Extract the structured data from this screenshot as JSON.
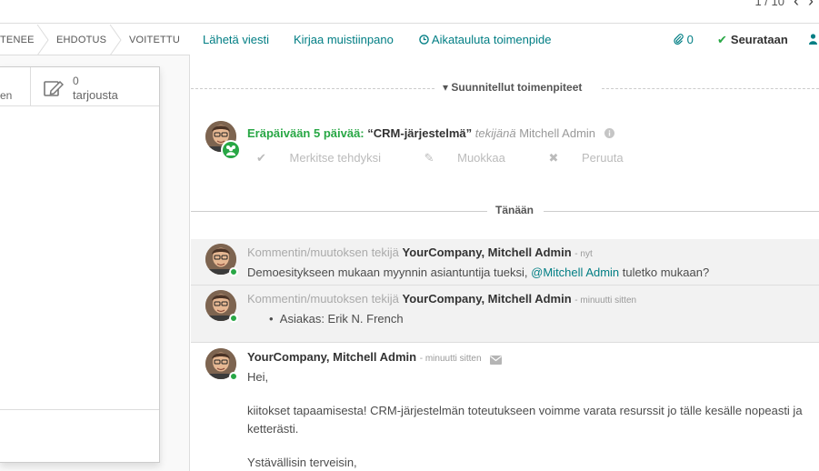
{
  "pager": {
    "text": "1 / 10",
    "prev_icon": "chevron-left-icon",
    "next_icon": "chevron-right-icon"
  },
  "statusbar": {
    "stages": [
      "TENEE",
      "EHDOTUS",
      "VOITETTU"
    ]
  },
  "stat_buttons": {
    "left_partial_label": "en",
    "quotations_count": "0",
    "quotations_label": "tarjousta",
    "icon": "pencil-square-icon"
  },
  "chatter": {
    "send_message": "Lähetä viesti",
    "log_note": "Kirjaa muistiinpano",
    "schedule_activity": "Aikatauluta toimenpide",
    "attachments_count": "0",
    "following_label": "Seurataan",
    "follow_check_icon": "check-icon",
    "person_icon": "user-icon"
  },
  "planned": {
    "separator": "Suunnitellut toimenpiteet",
    "activity": {
      "due": "Eräpäivään 5 päivää:",
      "title": "“CRM-järjestelmä”",
      "for_label": "tekijänä",
      "user": "Mitchell Admin",
      "mark_done": "Merkitse tehdyksi",
      "edit": "Muokkaa",
      "cancel": "Peruuta",
      "badge_icon": "meeting-group-icon"
    }
  },
  "today_separator": "Tänään",
  "messages": [
    {
      "type": "note",
      "prefix": "Kommentin/muutoksen tekijä",
      "author": "YourCompany, Mitchell Admin",
      "when": "- nyt",
      "body_before": "Demoesitykseen mukaan myynnin asiantuntija tueksi, ",
      "mention": "@Mitchell Admin",
      "body_after": " tuletko mukaan?"
    },
    {
      "type": "note",
      "prefix": "Kommentin/muutoksen tekijä",
      "author": "YourCompany, Mitchell Admin",
      "when": "- minuutti sitten",
      "bullet": "Asiakas: Erik N. French"
    },
    {
      "type": "email",
      "author": "YourCompany, Mitchell Admin",
      "when": "- minuutti sitten",
      "line1": "Hei,",
      "line2": "kiitokset tapaamisesta! CRM-järjestelmän toteutukseen voimme varata resurssit jo tälle kesälle nopeasti ja",
      "line3": "ketterästi.",
      "line4": "Ystävällisin terveisin,"
    }
  ],
  "colors": {
    "accent": "#017e84",
    "success": "#28a745",
    "note_bg": "#f2f2f2"
  }
}
